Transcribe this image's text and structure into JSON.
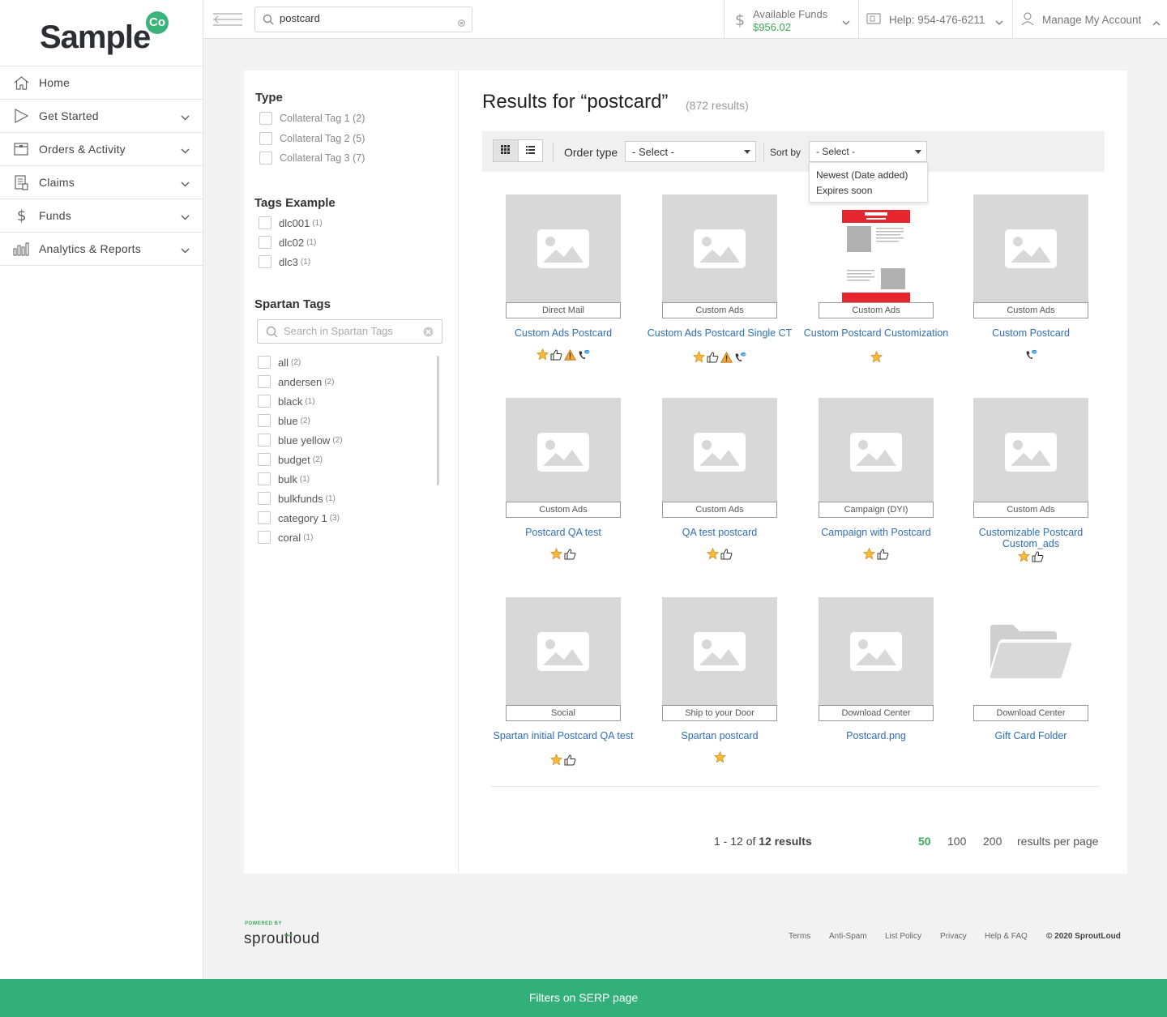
{
  "brand": {
    "logo_text": "Sample",
    "logo_badge": "Co",
    "accent": "#3cb37a"
  },
  "sidebar": {
    "items": [
      {
        "label": "Home",
        "icon": "home-icon",
        "expandable": false
      },
      {
        "label": "Get Started",
        "icon": "play-icon",
        "expandable": true
      },
      {
        "label": "Orders & Activity",
        "icon": "orders-icon",
        "expandable": true
      },
      {
        "label": "Claims",
        "icon": "claims-icon",
        "expandable": true
      },
      {
        "label": "Funds",
        "icon": "dollar-icon",
        "expandable": true
      },
      {
        "label": "Analytics & Reports",
        "icon": "bar-chart-icon",
        "expandable": true
      }
    ]
  },
  "header": {
    "search_value": "postcard",
    "funds_label": "Available Funds",
    "funds_value": "$956.02",
    "help_text": "Help: 954-476-6211",
    "account_text": "Manage My Account"
  },
  "filters": {
    "type_title": "Type",
    "type_items": [
      {
        "label": "Collateral Tag 1 (2)"
      },
      {
        "label": "Collateral Tag 2 (5)"
      },
      {
        "label": "Collateral Tag 3 (7)"
      }
    ],
    "tags_title": "Tags Example",
    "tags_items": [
      {
        "label": "dlc001",
        "count": "(1)"
      },
      {
        "label": "dlc02",
        "count": "(1)"
      },
      {
        "label": "dlc3",
        "count": "(1)"
      }
    ],
    "spartan_title": "Spartan Tags",
    "spartan_placeholder": "Search in Spartan Tags",
    "spartan_items": [
      {
        "label": "all",
        "count": "(2)"
      },
      {
        "label": "andersen",
        "count": "(2)"
      },
      {
        "label": "black",
        "count": "(1)"
      },
      {
        "label": "blue",
        "count": "(2)"
      },
      {
        "label": "blue yellow",
        "count": "(2)"
      },
      {
        "label": "budget",
        "count": "(2)"
      },
      {
        "label": "bulk",
        "count": "(1)"
      },
      {
        "label": "bulkfunds",
        "count": "(1)"
      },
      {
        "label": "category 1",
        "count": "(3)"
      },
      {
        "label": "coral",
        "count": "(1)"
      }
    ]
  },
  "results": {
    "title": "Results for “postcard”",
    "count_text": "(872 results)",
    "order_type_label": "Order type",
    "order_type_value": "- Select -",
    "sort_by_label": "Sort by",
    "sort_by_value": "- Select -",
    "sort_options": [
      "Newest (Date added)",
      "Expires soon"
    ],
    "cards": [
      {
        "tag": "Direct Mail",
        "title": "Custom Ads Postcard",
        "icons": [
          "star-icon",
          "thumbs-up-icon",
          "warning-icon",
          "phone-icon"
        ],
        "thumb": "image"
      },
      {
        "tag": "Custom Ads",
        "title": "Custom Ads Postcard Single CT",
        "icons": [
          "star-icon",
          "thumbs-up-icon",
          "warning-icon",
          "phone-icon"
        ],
        "thumb": "image"
      },
      {
        "tag": "Custom Ads",
        "title": "Custom Postcard Customization",
        "icons": [
          "star-icon"
        ],
        "thumb": "document"
      },
      {
        "tag": "Custom Ads",
        "title": "Custom Postcard",
        "icons": [
          "phone-icon"
        ],
        "thumb": "image"
      },
      {
        "tag": "Custom Ads",
        "title": "Postcard QA test",
        "icons": [
          "star-icon",
          "thumbs-up-icon"
        ],
        "thumb": "image"
      },
      {
        "tag": "Custom Ads",
        "title": "QA test postcard",
        "icons": [
          "star-icon",
          "thumbs-up-icon"
        ],
        "thumb": "image"
      },
      {
        "tag": "Campaign (DYI)",
        "title": "Campaign with Postcard",
        "icons": [
          "star-icon",
          "thumbs-up-icon"
        ],
        "thumb": "image"
      },
      {
        "tag": "Custom Ads",
        "title": "Customizable Postcard Custom_ads",
        "icons": [
          "star-icon",
          "thumbs-up-icon"
        ],
        "thumb": "image"
      },
      {
        "tag": "Social",
        "title": "Spartan initial Postcard QA test",
        "icons": [
          "star-icon",
          "thumbs-up-icon"
        ],
        "thumb": "image"
      },
      {
        "tag": "Ship to your Door",
        "title": "Spartan postcard",
        "icons": [
          "star-icon"
        ],
        "thumb": "image"
      },
      {
        "tag": "Download Center",
        "title": "Postcard.png",
        "icons": [],
        "thumb": "image"
      },
      {
        "tag": "Download Center",
        "title": "Gift Card Folder",
        "icons": [],
        "thumb": "folder"
      }
    ],
    "pager_prefix": "1 - 12 of ",
    "pager_total": "12 results",
    "per_page_options": [
      "50",
      "100",
      "200"
    ],
    "per_page_active": "50",
    "per_page_label": "results per page"
  },
  "footer": {
    "powered_by": "POWERED BY",
    "brand": "sproutloud",
    "links": [
      "Terms",
      "Anti-Spam",
      "List Policy",
      "Privacy",
      "Help & FAQ"
    ],
    "copyright": "© 2020 SproutLoud"
  },
  "caption": "Filters on SERP page"
}
